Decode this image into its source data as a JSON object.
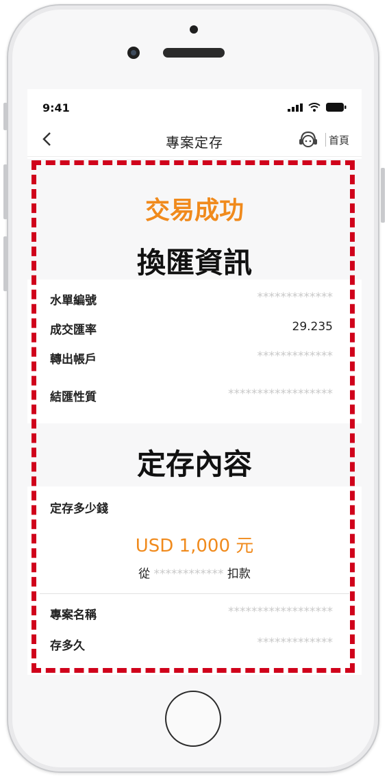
{
  "status_bar": {
    "time": "9:41"
  },
  "nav": {
    "title": "專案定存",
    "home_label": "首頁"
  },
  "result": {
    "title": "交易成功"
  },
  "fx_section": {
    "title": "換匯資訊",
    "rows": [
      {
        "label": "水單編號",
        "value": "*************"
      },
      {
        "label": "成交匯率",
        "value": "29.235"
      },
      {
        "label": "轉出帳戶",
        "value": "*************"
      },
      {
        "label": "結匯性質",
        "value": "******************"
      }
    ]
  },
  "deposit_section": {
    "title": "定存內容",
    "amount_label": "定存多少錢",
    "amount": "USD 1,000 元",
    "from_prefix": "從",
    "from_account": "************",
    "from_suffix": "扣款",
    "rows": [
      {
        "label": "專案名稱",
        "value": "******************"
      },
      {
        "label": "存多久",
        "value": "*************"
      }
    ]
  },
  "colors": {
    "accent": "#f08a1c",
    "highlight_border": "#d0021b"
  }
}
